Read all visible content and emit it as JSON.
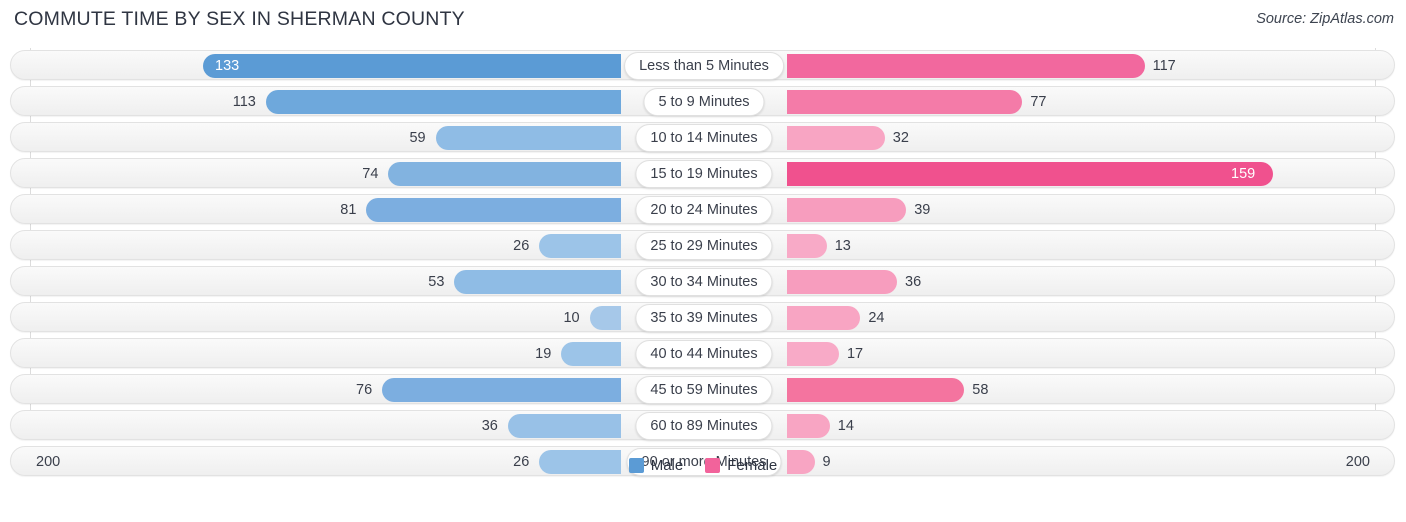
{
  "header": {
    "title": "COMMUTE TIME BY SEX IN SHERMAN COUNTY",
    "source": "Source: ZipAtlas.com"
  },
  "axis": {
    "left_label": "200",
    "right_label": "200",
    "max": 200
  },
  "legend": {
    "items": [
      {
        "label": "Male",
        "color": "#5b9bd5"
      },
      {
        "label": "Female",
        "color": "#f2639b"
      }
    ]
  },
  "colors": {
    "male_strong": "#5b9bd5",
    "male_mid": "#82b3e0",
    "male_light": "#a6c8e9",
    "female_strong": "#f0518e",
    "female_mid": "#f47ca9",
    "female_light": "#f7a0c0",
    "track_bg": "#f5f5f5",
    "track_border": "#e2e2e2",
    "gridline": "#dcdcdc",
    "text": "#3a3f4b"
  },
  "chart_data": {
    "type": "bar",
    "title": "COMMUTE TIME BY SEX IN SHERMAN COUNTY",
    "subtitle": "",
    "orientation": "horizontal-diverging",
    "xlabel": "",
    "ylabel": "",
    "xlim": [
      200,
      200
    ],
    "grid": true,
    "legend_position": "bottom-center",
    "categories": [
      "Less than 5 Minutes",
      "5 to 9 Minutes",
      "10 to 14 Minutes",
      "15 to 19 Minutes",
      "20 to 24 Minutes",
      "25 to 29 Minutes",
      "30 to 34 Minutes",
      "35 to 39 Minutes",
      "40 to 44 Minutes",
      "45 to 59 Minutes",
      "60 to 89 Minutes",
      "90 or more Minutes"
    ],
    "series": [
      {
        "name": "Male",
        "color": "#5b9bd5",
        "values": [
          133,
          113,
          59,
          74,
          81,
          26,
          53,
          10,
          19,
          76,
          36,
          26
        ]
      },
      {
        "name": "Female",
        "color": "#f2639b",
        "values": [
          117,
          77,
          32,
          159,
          39,
          13,
          36,
          24,
          17,
          58,
          14,
          9
        ]
      }
    ]
  },
  "rows": [
    {
      "label": "Less than 5 Minutes",
      "male": 133,
      "female": 117,
      "male_inside": true,
      "female_inside": false,
      "male_color": "#5b9bd5",
      "female_color": "#f2689e"
    },
    {
      "label": "5 to 9 Minutes",
      "male": 113,
      "female": 77,
      "male_inside": false,
      "female_inside": false,
      "male_color": "#6ea8dc",
      "female_color": "#f47ba8"
    },
    {
      "label": "10 to 14 Minutes",
      "male": 59,
      "female": 32,
      "male_inside": false,
      "female_inside": false,
      "male_color": "#8fbce5",
      "female_color": "#f8a5c3"
    },
    {
      "label": "15 to 19 Minutes",
      "male": 74,
      "female": 159,
      "male_inside": false,
      "female_inside": true,
      "male_color": "#82b3e0",
      "female_color": "#f0518e"
    },
    {
      "label": "20 to 24 Minutes",
      "male": 81,
      "female": 39,
      "male_inside": false,
      "female_inside": false,
      "male_color": "#7caee0",
      "female_color": "#f79dbe"
    },
    {
      "label": "25 to 29 Minutes",
      "male": 26,
      "female": 13,
      "male_inside": false,
      "female_inside": false,
      "male_color": "#9cc4e8",
      "female_color": "#f8aac7"
    },
    {
      "label": "30 to 34 Minutes",
      "male": 53,
      "female": 36,
      "male_inside": false,
      "female_inside": false,
      "male_color": "#8fbce5",
      "female_color": "#f79dbe"
    },
    {
      "label": "35 to 39 Minutes",
      "male": 10,
      "female": 24,
      "male_inside": false,
      "female_inside": false,
      "male_color": "#a6c8e9",
      "female_color": "#f8a5c3"
    },
    {
      "label": "40 to 44 Minutes",
      "male": 19,
      "female": 17,
      "male_inside": false,
      "female_inside": false,
      "male_color": "#9cc4e8",
      "female_color": "#f8aac7"
    },
    {
      "label": "45 to 59 Minutes",
      "male": 76,
      "female": 58,
      "male_inside": false,
      "female_inside": false,
      "male_color": "#7caee0",
      "female_color": "#f4749f"
    },
    {
      "label": "60 to 89 Minutes",
      "male": 36,
      "female": 14,
      "male_inside": false,
      "female_inside": false,
      "male_color": "#98c1e7",
      "female_color": "#f8a5c3"
    },
    {
      "label": "90 or more Minutes",
      "male": 26,
      "female": 9,
      "male_inside": false,
      "female_inside": false,
      "male_color": "#9cc4e8",
      "female_color": "#f8a5c3"
    }
  ]
}
